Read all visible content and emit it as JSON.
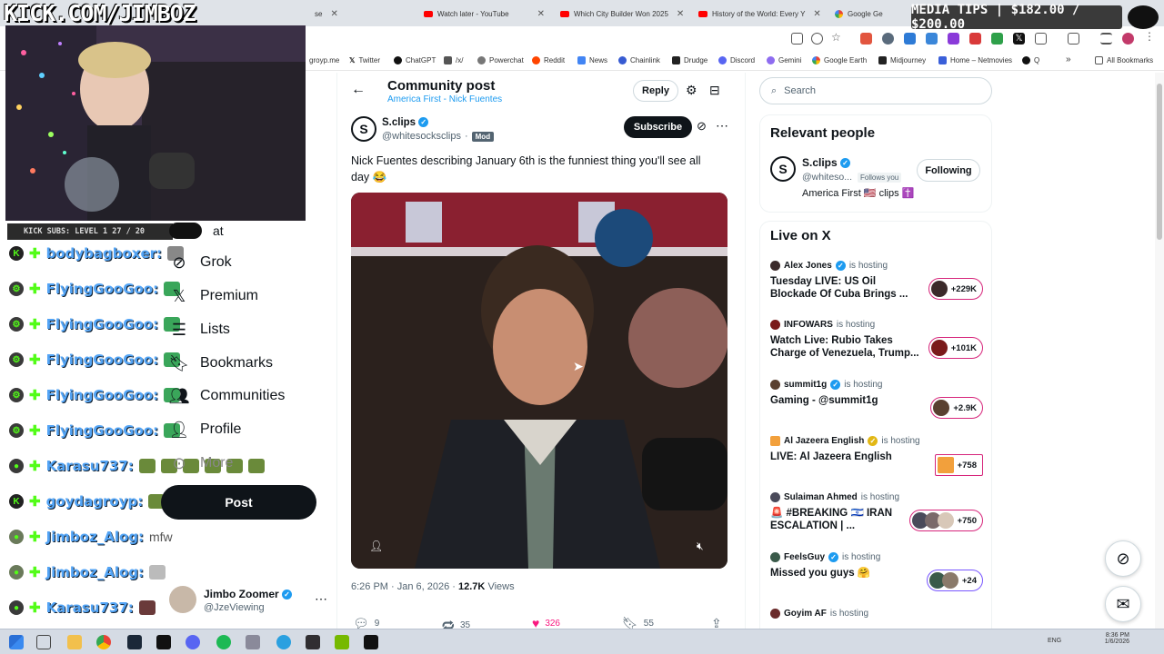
{
  "overlay": {
    "title": "KICK.COM/JIMBOZ",
    "media_tips": "MEDIA TIPS | $182.00 / $200.00",
    "kick_subs": "KICK SUBS: LEVEL 1 27 / 20"
  },
  "browser": {
    "tabs": [
      {
        "label": "se"
      },
      {
        "label": "Watch later - YouTube"
      },
      {
        "label": "Which City Builder Won 2025"
      },
      {
        "label": "History of the World: Every Y"
      },
      {
        "label": "Google Ge"
      }
    ],
    "bookmarks": [
      {
        "label": "groyp.me"
      },
      {
        "label": "Twitter"
      },
      {
        "label": "ChatGPT"
      },
      {
        "label": "/x/"
      },
      {
        "label": "Powerchat"
      },
      {
        "label": "Reddit"
      },
      {
        "label": "News"
      },
      {
        "label": "Chainlink"
      },
      {
        "label": "Drudge"
      },
      {
        "label": "Discord"
      },
      {
        "label": "Gemini"
      },
      {
        "label": "Google Earth"
      },
      {
        "label": "Midjourney"
      },
      {
        "label": "Home – Netmovies"
      },
      {
        "label": "Q"
      },
      {
        "label": "All Bookmarks"
      }
    ]
  },
  "chat": [
    {
      "name": "bodybagboxer:",
      "msg": ""
    },
    {
      "name": "FlyingGooGoo:",
      "msg": ""
    },
    {
      "name": "FlyingGooGoo:",
      "msg": ""
    },
    {
      "name": "FlyingGooGoo:",
      "msg": ""
    },
    {
      "name": "FlyingGooGoo:",
      "msg": ""
    },
    {
      "name": "FlyingGooGoo:",
      "msg": ""
    },
    {
      "name": "Karasu737:",
      "msg": ""
    },
    {
      "name": "goydagroyp:",
      "msg": ""
    },
    {
      "name": "Jimboz_Alog:",
      "msg": "mfw"
    },
    {
      "name": "Jimboz_Alog:",
      "msg": ""
    },
    {
      "name": "Karasu737:",
      "msg": ""
    }
  ],
  "nav": {
    "chat_partial": "at",
    "items": [
      {
        "label": "Grok",
        "icon": "grok-icon"
      },
      {
        "label": "Premium",
        "icon": "x-icon"
      },
      {
        "label": "Lists",
        "icon": "list-icon"
      },
      {
        "label": "Bookmarks",
        "icon": "bookmark-icon"
      },
      {
        "label": "Communities",
        "icon": "communities-icon"
      },
      {
        "label": "Profile",
        "icon": "profile-icon"
      },
      {
        "label": "More",
        "icon": "more-icon"
      }
    ],
    "post_label": "Post",
    "me": {
      "name": "Jimbo Zoomer",
      "handle": "@JzeViewing"
    }
  },
  "post": {
    "header_title": "Community post",
    "community": "America First - Nick Fuentes",
    "reply_label": "Reply",
    "author_name": "S.clips",
    "author_handle": "@whitesocksclips",
    "mod_badge": "Mod",
    "subscribe_label": "Subscribe",
    "text": "Nick Fuentes describing January 6th is the funniest thing you'll see all day 😂",
    "time": "6:26 PM · Jan 6, 2026 ·",
    "views_count": "12.7K",
    "views_label": "Views",
    "replies": "9",
    "reposts": "35",
    "likes": "326",
    "bookmarks": "55"
  },
  "sidebar": {
    "search_placeholder": "Search",
    "relevant_title": "Relevant people",
    "person": {
      "name": "S.clips",
      "handle": "@whiteso...",
      "follows_you": "Follows you",
      "bio": "America First 🇺🇸 clips ✝️",
      "following_label": "Following"
    },
    "live_title": "Live on X",
    "hosting_label": "is hosting",
    "live": [
      {
        "host": "Alex Jones",
        "title": "Tuesday LIVE: US Oil Blockade Of Cuba Brings ...",
        "count": "+229K",
        "color": "#3b2a2a"
      },
      {
        "host": "INFOWARS",
        "title": "Watch Live: Rubio Takes Charge of Venezuela, Trump...",
        "count": "+101K",
        "color": "#7a1a1a"
      },
      {
        "host": "summit1g",
        "title": "Gaming - @summit1g",
        "count": "+2.9K",
        "color": "#5a4030"
      },
      {
        "host": "Al Jazeera English",
        "title": "LIVE: Al Jazeera English",
        "count": "+758",
        "color": "#f2a03c"
      },
      {
        "host": "Sulaiman Ahmed",
        "title": "🚨 #BREAKING 🇮🇱 IRAN ESCALATION | ...",
        "count": "+750",
        "color": "#4a4a5a"
      },
      {
        "host": "FeelsGuy",
        "title": "Missed you guys 🤗",
        "count": "+24",
        "color": "#3a5a4a"
      },
      {
        "host": "Goyim AF",
        "title": "",
        "count": "",
        "color": "#6a2a2a"
      }
    ]
  },
  "system": {
    "lang": "ENG",
    "time": "8:36 PM",
    "date": "1/6/2026"
  }
}
